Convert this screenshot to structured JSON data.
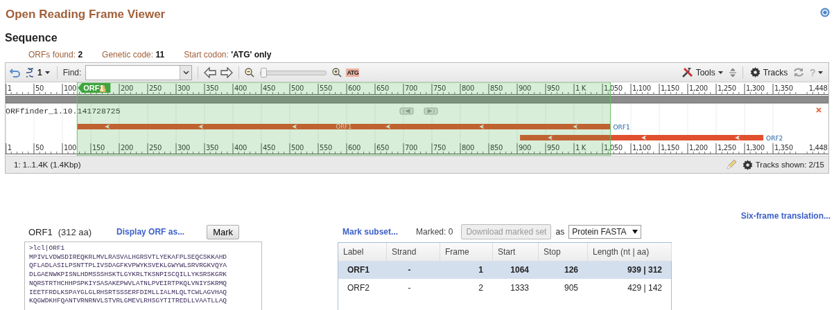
{
  "page_title": "Open Reading Frame Viewer",
  "section_title": "Sequence",
  "summary": [
    {
      "label": "ORFs found:",
      "value": "2"
    },
    {
      "label": "Genetic code:",
      "value": "11"
    },
    {
      "label": "Start codon:",
      "value": "'ATG' only"
    }
  ],
  "toolbar": {
    "strand_count": "1",
    "find_label": "Find:",
    "slider": {
      "level": 0.03
    },
    "atg": "ATG",
    "tools": "Tools",
    "tracks": "Tracks",
    "help": "?"
  },
  "top_ruler": [
    "1",
    "50",
    "100",
    "200",
    "250",
    "300",
    "350",
    "400",
    "450",
    "500",
    "550",
    "600",
    "650",
    "700",
    "750",
    "800",
    "850",
    "900",
    "950",
    "1 K",
    "1,050",
    "1,100",
    "1,150",
    "1,200",
    "1,250",
    "1,300",
    "1,350",
    "1,448"
  ],
  "bottom_ruler": [
    "1",
    "50",
    "100",
    "150",
    "200",
    "250",
    "300",
    "350",
    "400",
    "450",
    "500",
    "550",
    "600",
    "650",
    "700",
    "750",
    "800",
    "850",
    "900",
    "950",
    "1 K",
    "1,050",
    "1,100",
    "1,150",
    "1,200",
    "1,250",
    "1,300",
    "1,350",
    "1,448"
  ],
  "track": {
    "flag_label": "ORF1",
    "name": "ORFfinder_1.10.141728725",
    "features": [
      {
        "label": "ORF1",
        "inner_label": "ORF1"
      },
      {
        "label": "ORF2"
      }
    ]
  },
  "status": {
    "range": "1: 1..1.4K (1.4Kbp)",
    "tracks_shown": "Tracks shown: 2/15"
  },
  "six_frame_link": "Six-frame translation...",
  "orf_panel": {
    "name": "ORF1",
    "length": "(312 aa)",
    "display_link": "Display ORF as...",
    "mark_button": "Mark",
    "fasta": [
      ">lcl|ORF1",
      "MPIVLVDWSDIREQKRLMVLRASVALHGRSVTLYEKAFPLSEQCSKKAHD",
      "QFLADLASILPSNTTPLIVSDAGFKVPWYKSVEKLGWYWLSRVRGKVQYA",
      "DLGAENWKPISNLHDMSSSHSKTLGYKRLTKSNPISCQILLYKSRSKGRK",
      "NQRSTRTHCHHPSPKIYSASAKEPWVLATNLPVEIRTPKQLVNIYSKRMQ",
      "IEETFRDLKSPAYGLGLRHSRTSSSERFDIMLLIALMLQLTCWLAGVHAQ",
      "KQGWDKHFQANTVRNRNVLSTVRLGMEVLRHSGYTITREDLLVAATLLAQ"
    ]
  },
  "export": {
    "mark_subset": "Mark subset...",
    "marked": "Marked: 0",
    "download": {
      "label": "Download marked set",
      "disabled": true
    },
    "as": "as",
    "format": "Protein FASTA"
  },
  "table": {
    "columns": [
      "Label",
      "Strand",
      "Frame",
      "Start",
      "Stop",
      "Length (nt | aa)"
    ],
    "rows": [
      {
        "label": "ORF1",
        "strand": "-",
        "frame": "1",
        "start": "1064",
        "stop": "126",
        "length": "939 | 312",
        "selected": true
      },
      {
        "label": "ORF2",
        "strand": "-",
        "frame": "2",
        "start": "1333",
        "stop": "905",
        "length": "429 | 142",
        "selected": false
      }
    ]
  }
}
